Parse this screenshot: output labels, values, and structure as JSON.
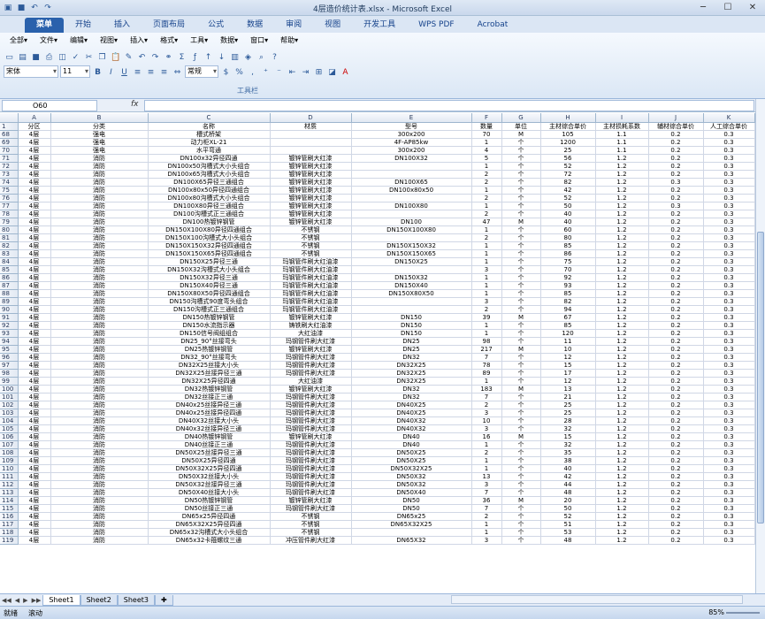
{
  "window": {
    "title": "4层造价统计表.xlsx - Microsoft Excel"
  },
  "tabs": [
    "菜单",
    "开始",
    "插入",
    "页面布局",
    "公式",
    "数据",
    "审阅",
    "视图",
    "开发工具",
    "WPS PDF",
    "Acrobat"
  ],
  "menus": [
    "全部▾",
    "文件▾",
    "编辑▾",
    "视图▾",
    "插入▾",
    "格式▾",
    "工具▾",
    "数据▾",
    "窗口▾",
    "帮助▾"
  ],
  "font_name": "宋体",
  "font_size": "11",
  "number_format": "常规",
  "toolbar_label": "工具栏",
  "name_box": "O60",
  "columns": [
    "",
    "A",
    "B",
    "C",
    "D",
    "E",
    "F",
    "G",
    "H",
    "I",
    "J",
    "K",
    "L"
  ],
  "header_row": [
    "1",
    "分区",
    "分类",
    "名称",
    "材质",
    "型号",
    "数量",
    "单位",
    "主材综合单价",
    "主材损耗系数",
    "辅材综合单价",
    "人工综合单价",
    "总价（元）"
  ],
  "rows": [
    [
      "68",
      "4层",
      "强电",
      "槽式桥架",
      "",
      "300x200",
      "70",
      "M",
      "105",
      "1.1",
      "0.2",
      "0.3",
      "11805.55"
    ],
    [
      "69",
      "4层",
      "强电",
      "动力柜XL-21",
      "",
      "4F-AP85kw",
      "1",
      "个",
      "1200",
      "1.1",
      "0.2",
      "0.3",
      "1920.00"
    ],
    [
      "70",
      "4层",
      "强电",
      "水平弯通",
      "",
      "300x200",
      "4",
      "个",
      "25",
      "1.1",
      "0.2",
      "0.3",
      "160.00"
    ],
    [
      "71",
      "4层",
      "消防",
      "DN100x32异径四通",
      "镀锌管刷大红漆",
      "DN100X32",
      "5",
      "个",
      "56",
      "1.2",
      "0.2",
      "0.3",
      "476.00"
    ],
    [
      "72",
      "4层",
      "消防",
      "DN100x50沟槽式大小头组合",
      "镀锌管刷大红漆",
      "",
      "1",
      "个",
      "52",
      "1.2",
      "0.2",
      "0.3",
      "88.40"
    ],
    [
      "73",
      "4层",
      "消防",
      "DN100x65沟槽式大小头组合",
      "镀锌管刷大红漆",
      "",
      "2",
      "个",
      "72",
      "1.2",
      "0.2",
      "0.3",
      "244.80"
    ],
    [
      "74",
      "4层",
      "消防",
      "DN100X65异径三通组合",
      "镀锌管刷大红漆",
      "DN100X65",
      "2",
      "个",
      "82",
      "1.2",
      "0.3",
      "0.3",
      "278.80"
    ],
    [
      "75",
      "4层",
      "消防",
      "DN100x80x50异径四通组合",
      "镀锌管刷大红漆",
      "DN100x80x50",
      "1",
      "个",
      "42",
      "1.2",
      "0.2",
      "0.3",
      "71.40"
    ],
    [
      "76",
      "4层",
      "消防",
      "DN100x80沟槽式大小头组合",
      "镀锌管刷大红漆",
      "",
      "2",
      "个",
      "52",
      "1.2",
      "0.2",
      "0.3",
      "176.80"
    ],
    [
      "77",
      "4层",
      "消防",
      "DN100X80异径三通组合",
      "镀锌管刷大红漆",
      "DN100X80",
      "1",
      "个",
      "50",
      "1.2",
      "0.3",
      "0.3",
      "85.00"
    ],
    [
      "78",
      "4层",
      "消防",
      "DN100沟槽式正三通组合",
      "镀锌管刷大红漆",
      "",
      "2",
      "个",
      "40",
      "1.2",
      "0.2",
      "0.3",
      "136.00"
    ],
    [
      "79",
      "4层",
      "消防",
      "DN100热镀锌钢管",
      "镀锌管刷大红漆",
      "DN100",
      "47",
      "M",
      "40",
      "1.2",
      "0.2",
      "0.3",
      "3171.31"
    ],
    [
      "80",
      "4层",
      "消防",
      "DN150X100X80异径四通组合",
      "不锈钢",
      "DN150X100X80",
      "1",
      "个",
      "60",
      "1.2",
      "0.2",
      "0.3",
      "102.00"
    ],
    [
      "81",
      "4层",
      "消防",
      "DN150X100沟槽式大小头组合",
      "不锈钢",
      "",
      "2",
      "个",
      "80",
      "1.2",
      "0.2",
      "0.3",
      "272.00"
    ],
    [
      "82",
      "4层",
      "消防",
      "DN150X150X32异径四通组合",
      "不锈钢",
      "DN150X150X32",
      "1",
      "个",
      "85",
      "1.2",
      "0.2",
      "0.3",
      "144.50"
    ],
    [
      "83",
      "4层",
      "消防",
      "DN150X150X65异径四通组合",
      "不锈钢",
      "DN150X150X65",
      "1",
      "个",
      "86",
      "1.2",
      "0.2",
      "0.3",
      "146.20"
    ],
    [
      "84",
      "4层",
      "消防",
      "DN150X25异径三通",
      "玛钢管件刷大红油漆",
      "DN150X25",
      "1",
      "个",
      "75",
      "1.2",
      "0.2",
      "0.3",
      "127.50"
    ],
    [
      "85",
      "4层",
      "消防",
      "DN150X32沟槽式大小头组合",
      "玛钢管件刷大红油漆",
      "",
      "3",
      "个",
      "70",
      "1.2",
      "0.2",
      "0.3",
      "357.00"
    ],
    [
      "86",
      "4层",
      "消防",
      "DN150X32异径三通",
      "玛钢管件刷大红油漆",
      "DN150X32",
      "1",
      "个",
      "92",
      "1.2",
      "0.2",
      "0.3",
      "156.40"
    ],
    [
      "87",
      "4层",
      "消防",
      "DN150X40异径三通",
      "玛钢管件刷大红油漆",
      "DN150X40",
      "1",
      "个",
      "93",
      "1.2",
      "0.2",
      "0.3",
      "158.10"
    ],
    [
      "88",
      "4层",
      "消防",
      "DN150X80X50异径四通组合",
      "玛钢管件刷大红油漆",
      "DN150X80X50",
      "1",
      "个",
      "85",
      "1.2",
      "0.2",
      "0.3",
      "144.50"
    ],
    [
      "89",
      "4层",
      "消防",
      "DN150沟槽式90度弯头组合",
      "玛钢管件刷大红油漆",
      "",
      "3",
      "个",
      "82",
      "1.2",
      "0.2",
      "0.3",
      "418.20"
    ],
    [
      "90",
      "4层",
      "消防",
      "DN150沟槽式正三通组合",
      "玛钢管件刷大红油漆",
      "",
      "2",
      "个",
      "94",
      "1.2",
      "0.2",
      "0.3",
      "319.60"
    ],
    [
      "91",
      "4层",
      "消防",
      "DN150热镀锌钢管",
      "镀锌管刷大红漆",
      "DN150",
      "39",
      "M",
      "67",
      "1.2",
      "0.2",
      "0.3",
      "4497.11"
    ],
    [
      "92",
      "4层",
      "消防",
      "DN150水流指示器",
      "铸铁刷大红油漆",
      "DN150",
      "1",
      "个",
      "85",
      "1.2",
      "0.2",
      "0.3",
      "144.50"
    ],
    [
      "93",
      "4层",
      "消防",
      "DN150信号阀组组合",
      "大红油漆",
      "DN150",
      "1",
      "个",
      "120",
      "1.2",
      "0.2",
      "0.3",
      "204.00"
    ],
    [
      "94",
      "4层",
      "消防",
      "DN25_90°丝接弯头",
      "玛钢管件刷大红漆",
      "DN25",
      "98",
      "个",
      "11",
      "1.2",
      "0.2",
      "0.3",
      "1832.60"
    ],
    [
      "95",
      "4层",
      "消防",
      "DN25热镀锌钢管",
      "镀锌管刷大红漆",
      "DN25",
      "217",
      "M",
      "10",
      "1.2",
      "0.2",
      "0.3",
      "3693.68"
    ],
    [
      "96",
      "4层",
      "消防",
      "DN32_90°丝接弯头",
      "玛钢管件刷大红漆",
      "DN32",
      "7",
      "个",
      "12",
      "1.2",
      "0.2",
      "0.3",
      "142.80"
    ],
    [
      "97",
      "4层",
      "消防",
      "DN32X25丝接大小头",
      "玛钢管件刷大红漆",
      "DN32X25",
      "78",
      "个",
      "15",
      "1.2",
      "0.2",
      "0.3",
      "1989.00"
    ],
    [
      "98",
      "4层",
      "消防",
      "DN32X25丝接异径三通",
      "玛钢管件刷大红漆",
      "DN32X25",
      "89",
      "个",
      "17",
      "1.2",
      "0.2",
      "0.3",
      "2572.10"
    ],
    [
      "99",
      "4层",
      "消防",
      "DN32X25异径四通",
      "大红油漆",
      "DN32X25",
      "1",
      "个",
      "12",
      "1.2",
      "0.2",
      "0.3",
      "20.40"
    ],
    [
      "100",
      "4层",
      "消防",
      "DN32热镀锌钢管",
      "镀锌管刷大红漆",
      "DN32",
      "183",
      "M",
      "13",
      "1.2",
      "0.2",
      "0.3",
      "4050.50"
    ],
    [
      "101",
      "4层",
      "消防",
      "DN32丝接正三通",
      "玛钢管件刷大红漆",
      "DN32",
      "7",
      "个",
      "21",
      "1.2",
      "0.2",
      "0.3",
      "249.90"
    ],
    [
      "102",
      "4层",
      "消防",
      "DN40x25丝接异径三通",
      "玛钢管件刷大红漆",
      "DN40X25",
      "2",
      "个",
      "25",
      "1.2",
      "0.2",
      "0.3",
      "85.00"
    ],
    [
      "103",
      "4层",
      "消防",
      "DN40x25丝接异径四通",
      "玛钢管件刷大红漆",
      "DN40X25",
      "3",
      "个",
      "25",
      "1.2",
      "0.2",
      "0.3",
      "127.50"
    ],
    [
      "104",
      "4层",
      "消防",
      "DN40X32丝接大小头",
      "玛钢管件刷大红漆",
      "DN40X32",
      "10",
      "个",
      "28",
      "1.2",
      "0.2",
      "0.3",
      "476.00"
    ],
    [
      "105",
      "4层",
      "消防",
      "DN40x32丝接异径三通",
      "玛钢管件刷大红漆",
      "DN40X32",
      "3",
      "个",
      "32",
      "1.2",
      "0.2",
      "0.3",
      "163.20"
    ],
    [
      "106",
      "4层",
      "消防",
      "DN40热镀锌钢管",
      "镀锌管刷大红漆",
      "DN40",
      "16",
      "M",
      "15",
      "1.2",
      "0.2",
      "0.3",
      "414.60"
    ],
    [
      "107",
      "4层",
      "消防",
      "DN40丝接正三通",
      "玛钢管件刷大红漆",
      "DN40",
      "1",
      "个",
      "32",
      "1.2",
      "0.2",
      "0.3",
      "54.40"
    ],
    [
      "108",
      "4层",
      "消防",
      "DN50X25丝接异径三通",
      "玛钢管件刷大红漆",
      "DN50X25",
      "2",
      "个",
      "35",
      "1.2",
      "0.2",
      "0.3",
      "119.00"
    ],
    [
      "109",
      "4层",
      "消防",
      "DN50X25异径四通",
      "玛钢管件刷大红漆",
      "DN50X25",
      "1",
      "个",
      "38",
      "1.2",
      "0.2",
      "0.3",
      "64.60"
    ],
    [
      "110",
      "4层",
      "消防",
      "DN50X32X25异径四通",
      "玛钢管件刷大红漆",
      "DN50X32X25",
      "1",
      "个",
      "40",
      "1.2",
      "0.2",
      "0.3",
      "68.00"
    ],
    [
      "111",
      "4层",
      "消防",
      "DN50X32丝接大小头",
      "玛钢管件刷大红漆",
      "DN50X32",
      "13",
      "个",
      "42",
      "1.2",
      "0.2",
      "0.3",
      "928.20"
    ],
    [
      "112",
      "4层",
      "消防",
      "DN50X32丝接异径三通",
      "玛钢管件刷大红漆",
      "DN50X32",
      "3",
      "个",
      "44",
      "1.2",
      "0.2",
      "0.3",
      "224.40"
    ],
    [
      "113",
      "4层",
      "消防",
      "DN50X40丝接大小头",
      "玛钢管件刷大红漆",
      "DN50X40",
      "7",
      "个",
      "48",
      "1.2",
      "0.2",
      "0.3",
      "571.20"
    ],
    [
      "114",
      "4层",
      "消防",
      "DN50热镀锌钢管",
      "镀锌管刷大红漆",
      "DN50",
      "36",
      "M",
      "20",
      "1.2",
      "0.2",
      "0.3",
      "1232.02"
    ],
    [
      "115",
      "4层",
      "消防",
      "DN50丝接正三通",
      "玛钢管件刷大红漆",
      "DN50",
      "7",
      "个",
      "50",
      "1.2",
      "0.2",
      "0.3",
      "595.00"
    ],
    [
      "116",
      "4层",
      "消防",
      "DN65x25异径四通",
      "不锈钢",
      "DN65x25",
      "2",
      "个",
      "52",
      "1.2",
      "0.2",
      "0.3",
      "176.80"
    ],
    [
      "117",
      "4层",
      "消防",
      "DN65X32X25异径四通",
      "不锈钢",
      "DN65X32X25",
      "1",
      "个",
      "51",
      "1.2",
      "0.2",
      "0.3",
      "86.70"
    ],
    [
      "118",
      "4层",
      "消防",
      "DN65x32沟槽式大小头组合",
      "不锈钢",
      "",
      "1",
      "个",
      "53",
      "1.2",
      "0.2",
      "0.3",
      "90.10"
    ],
    [
      "119",
      "4层",
      "消防",
      "DN65x32卡箍螺纹三通",
      "冲压管件刷大红漆",
      "DN65X32",
      "3",
      "个",
      "48",
      "1.2",
      "0.2",
      "0.3",
      "244.80"
    ]
  ],
  "sheets": [
    "Sheet1",
    "Sheet2",
    "Sheet3"
  ],
  "status": {
    "ready": "就绪",
    "scroll": "滚动",
    "zoom": "85%"
  }
}
